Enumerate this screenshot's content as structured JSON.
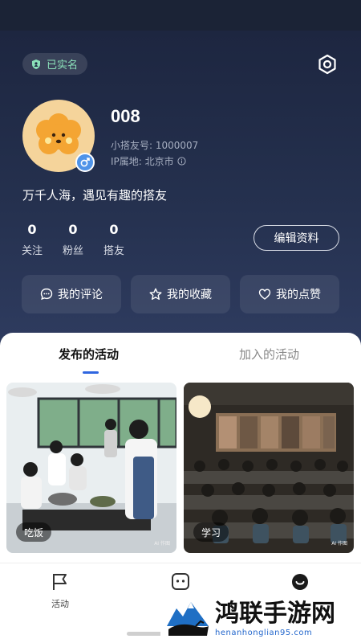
{
  "profile": {
    "verified_label": "已实名",
    "nickname": "008",
    "partner_id": "小搭友号: 1000007",
    "ip_location": "IP属地: 北京市",
    "bio": "万千人海，遇见有趣的搭友"
  },
  "stats": [
    {
      "value": "0",
      "label": "关注"
    },
    {
      "value": "0",
      "label": "粉丝"
    },
    {
      "value": "0",
      "label": "搭友"
    }
  ],
  "edit_button_label": "编辑资料",
  "quick_actions": [
    {
      "label": "我的评论",
      "icon": "comment-icon"
    },
    {
      "label": "我的收藏",
      "icon": "star-icon"
    },
    {
      "label": "我的点赞",
      "icon": "heart-icon"
    }
  ],
  "tabs": [
    {
      "label": "发布的活动",
      "active": true
    },
    {
      "label": "加入的活动",
      "active": false
    }
  ],
  "activities": [
    {
      "tag": "吃饭",
      "ai_mark": "AI 作图"
    },
    {
      "tag": "学习",
      "ai_mark": "AI 作图"
    }
  ],
  "bottom_nav": [
    {
      "label": "活动",
      "icon": "flag-icon"
    },
    {
      "label": "",
      "icon": "chat-icon"
    },
    {
      "label": "",
      "icon": "profile-icon"
    }
  ],
  "watermark": {
    "title": "鸿联手游网",
    "url": "henanhonglian95.com"
  },
  "colors": {
    "header_bg": "#1f2a44",
    "accent": "#2f66e0",
    "verified": "#8be0b9",
    "gender_badge": "#4f93e8",
    "avatar_bg": "#f5d49b"
  }
}
